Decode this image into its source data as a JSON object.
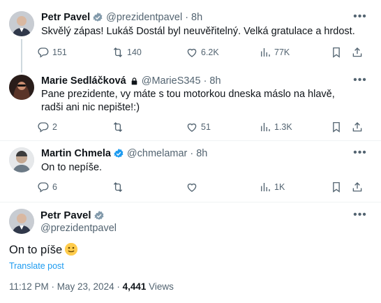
{
  "colors": {
    "accent": "#1d9bf0",
    "verified": "#1d9bf0",
    "muted": "#536471",
    "text": "#0f1419"
  },
  "tweets": [
    {
      "name": "Petr Pavel",
      "handle": "@prezidentpavel",
      "time": "8h",
      "verified": "gray-check-badge-icon",
      "text": "Skvělý zápas! Lukáš Dostál byl neuvěřitelný. Velká gratulace a hrdost.",
      "replies": "151",
      "reposts": "140",
      "likes": "6.2K",
      "views": "77K"
    },
    {
      "name": "Marie Sedláčková",
      "handle": "@MarieS345",
      "time": "8h",
      "verified": "lock-icon",
      "text": "Pane prezidente, vy máte s tou motorkou dneska máslo na hlavě, radši ani nic nepište!:)",
      "replies": "2",
      "reposts": "",
      "likes": "51",
      "views": "1.3K"
    },
    {
      "name": "Martin Chmela",
      "handle": "@chmelamar",
      "time": "8h",
      "verified": "blue-check-badge-icon",
      "text": "On to nepíše.",
      "replies": "6",
      "reposts": "",
      "likes": "",
      "views": "1K"
    }
  ],
  "main_post": {
    "name": "Petr Pavel",
    "handle": "@prezidentpavel",
    "text": "On to píše",
    "emoji": "slightly-smiling-face",
    "translate": "Translate post",
    "timestamp": "11:12 PM · May 23, 2024 · ",
    "views_count": "4,441",
    "views_label": " Views"
  },
  "icons": [
    "reply-icon",
    "repost-icon",
    "like-icon",
    "views-icon",
    "bookmark-icon",
    "share-icon",
    "more-icon"
  ]
}
